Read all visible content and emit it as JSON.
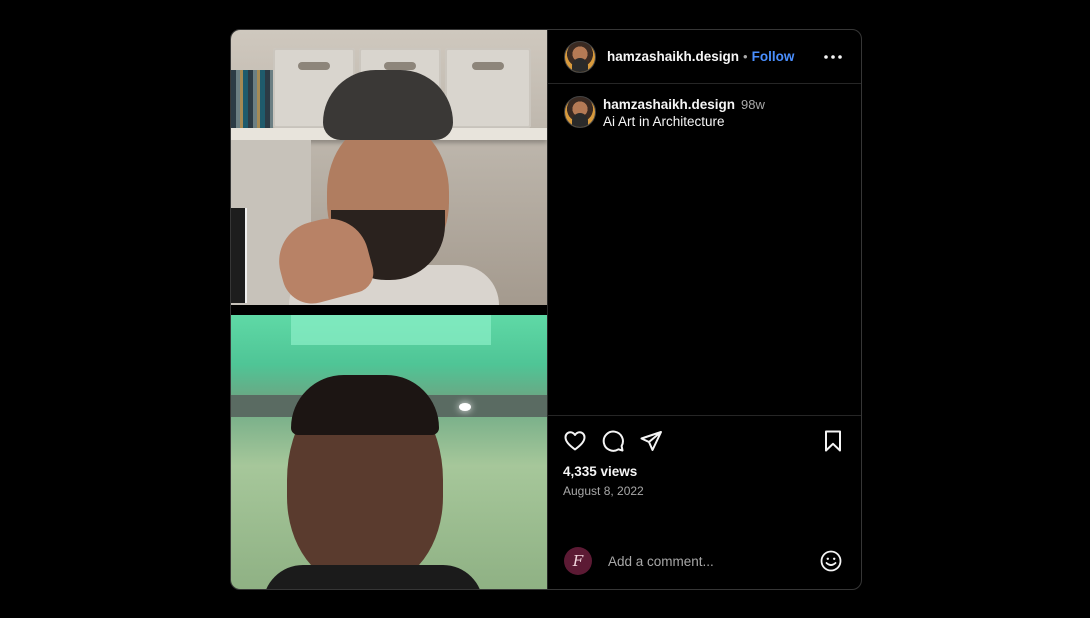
{
  "header": {
    "username": "hamzashaikh.design",
    "separator": "•",
    "follow_label": "Follow",
    "more_icon": "more-options-icon"
  },
  "caption": {
    "username": "hamzashaikh.design",
    "time": "98w",
    "text": "Ai Art in Architecture"
  },
  "actions": {
    "like_icon": "heart-icon",
    "comment_icon": "comment-icon",
    "share_icon": "share-icon",
    "save_icon": "bookmark-icon"
  },
  "stats": {
    "views": "4,335 views",
    "date": "August 8, 2022"
  },
  "comment": {
    "avatar_letter": "F",
    "placeholder": "Add a comment...",
    "emoji_icon": "emoji-icon"
  },
  "colors": {
    "background": "#000000",
    "follow": "#4a8fff",
    "border": "#262626",
    "secondary_text": "#a8a8a8"
  }
}
